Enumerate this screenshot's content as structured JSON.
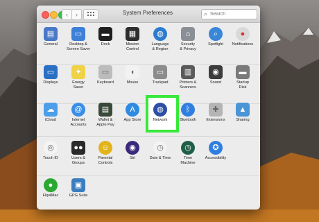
{
  "window": {
    "title": "System Preferences",
    "nav_back": "‹",
    "nav_forward": "›",
    "grid_icon": "grid-icon",
    "search": {
      "value": "",
      "placeholder": "Search"
    }
  },
  "selected_item": "Network",
  "rows": [
    [
      {
        "label": "General",
        "icon": "general-icon",
        "color": "#4a79c7"
      },
      {
        "label": "Desktop &\nScreen Saver",
        "icon": "desktop-icon",
        "color": "#3d80d8"
      },
      {
        "label": "Dock",
        "icon": "dock-icon",
        "color": "#202020"
      },
      {
        "label": "Mission\nControl",
        "icon": "mission-control-icon",
        "color": "#2e2e2e"
      },
      {
        "label": "Language\n& Region",
        "icon": "globe-flag-icon",
        "color": "#2d7bd1"
      },
      {
        "label": "Security\n& Privacy",
        "icon": "house-lock-icon",
        "color": "#8a8f96"
      },
      {
        "label": "Spotlight",
        "icon": "magnifier-icon",
        "color": "#3a86d8"
      },
      {
        "label": "Notifications",
        "icon": "notifications-icon",
        "color": "#d9d9d9"
      }
    ],
    [
      {
        "label": "Displays",
        "icon": "display-icon",
        "color": "#2b6fc4"
      },
      {
        "label": "Energy\nSaver",
        "icon": "lightbulb-icon",
        "color": "#f0d246"
      },
      {
        "label": "Keyboard",
        "icon": "keyboard-icon",
        "color": "#bcbcbc"
      },
      {
        "label": "Mouse",
        "icon": "mouse-icon",
        "color": "#f2f2f2"
      },
      {
        "label": "Trackpad",
        "icon": "trackpad-icon",
        "color": "#8c8c8c"
      },
      {
        "label": "Printers &\nScanners",
        "icon": "printer-icon",
        "color": "#5a5a5a"
      },
      {
        "label": "Sound",
        "icon": "speaker-icon",
        "color": "#3c3c3c"
      },
      {
        "label": "Startup\nDisk",
        "icon": "disk-icon",
        "color": "#7a7a7a"
      }
    ],
    [
      {
        "label": "iCloud",
        "icon": "cloud-icon",
        "color": "#4d9ee8"
      },
      {
        "label": "Internet\nAccounts",
        "icon": "at-icon",
        "color": "#3a8ee6"
      },
      {
        "label": "Wallet &\nApple Pay",
        "icon": "wallet-icon",
        "color": "#3a4a3a"
      },
      {
        "label": "App Store",
        "icon": "app-store-icon",
        "color": "#2e8be0"
      },
      {
        "label": "Network",
        "icon": "network-globe-icon",
        "color": "#2b4fa6"
      },
      {
        "label": "Bluetooth",
        "icon": "bluetooth-icon",
        "color": "#2f7fe0"
      },
      {
        "label": "Extensions",
        "icon": "puzzle-icon",
        "color": "#b5b5b5"
      },
      {
        "label": "Sharing",
        "icon": "sharing-folder-icon",
        "color": "#4a95d6"
      }
    ],
    [
      {
        "label": "Touch ID",
        "icon": "fingerprint-icon",
        "color": "#f4f4f4"
      },
      {
        "label": "Users &\nGroups",
        "icon": "users-icon",
        "color": "#2a2a2a"
      },
      {
        "label": "Parental\nControls",
        "icon": "parental-icon",
        "color": "#e2b41c"
      },
      {
        "label": "Siri",
        "icon": "siri-icon",
        "color": "#3b2a7a"
      },
      {
        "label": "Date & Time",
        "icon": "clock-icon",
        "color": "#f2f2f2"
      },
      {
        "label": "Time\nMachine",
        "icon": "time-machine-icon",
        "color": "#1f5f48"
      },
      {
        "label": "Accessibility",
        "icon": "accessibility-icon",
        "color": "#2f7fe0"
      }
    ],
    [
      {
        "label": "Flip4Mac",
        "icon": "flip4mac-icon",
        "color": "#2aa832"
      },
      {
        "label": "GPG Suite",
        "icon": "gpg-lock-icon",
        "color": "#3b7dbf"
      }
    ]
  ]
}
